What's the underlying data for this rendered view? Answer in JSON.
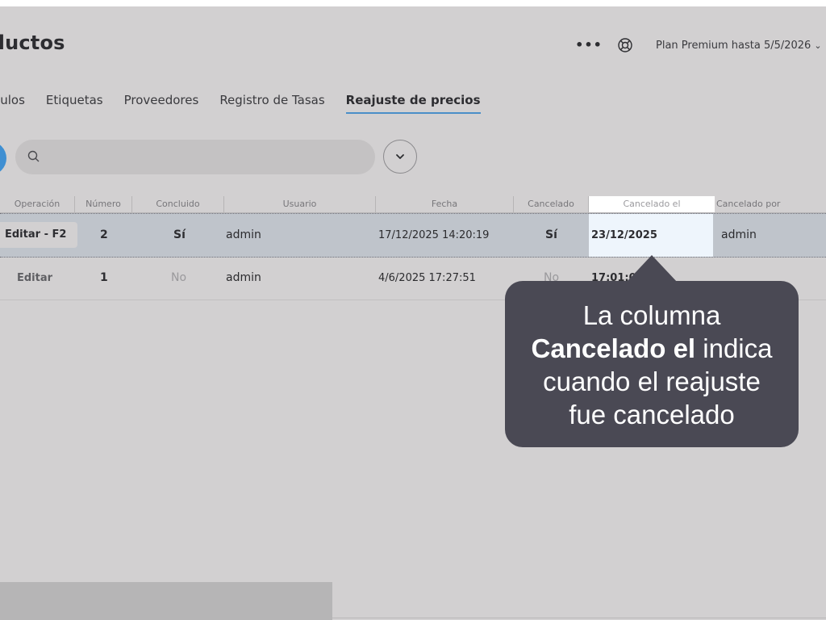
{
  "header": {
    "title": "oductos",
    "more_glyph": "•••",
    "help_icon": "lifebuoy-icon",
    "plan_label": "Plan Premium hasta 5/5/2026"
  },
  "tabs": [
    {
      "label": "culos"
    },
    {
      "label": "Etiquetas"
    },
    {
      "label": "Proveedores"
    },
    {
      "label": "Registro de Tasas"
    },
    {
      "label": "Reajuste de precios",
      "active": true
    }
  ],
  "search": {
    "placeholder": "",
    "icon": "search-icon"
  },
  "filter": {
    "icon": "chevron-down-icon"
  },
  "table": {
    "columns": [
      "Operación",
      "Número",
      "Concluido",
      "Usuario",
      "Fecha",
      "Cancelado",
      "Cancelado el",
      "Cancelado por"
    ],
    "rows": [
      {
        "operacion": "Editar - F2",
        "numero": "2",
        "concluido": "Sí",
        "usuario": "admin",
        "fecha": "17/12/2025 14:20:19",
        "cancelado": "Sí",
        "cancelado_el": "23/12/2025 17:01:01",
        "cancelado_por": "admin"
      },
      {
        "operacion": "Editar",
        "numero": "1",
        "concluido": "No",
        "usuario": "admin",
        "fecha": "4/6/2025 17:27:51",
        "cancelado": "No",
        "cancelado_el": "",
        "cancelado_por": ""
      }
    ]
  },
  "callout": {
    "line1": "La columna",
    "bold": "Cancelado el",
    "after_bold": " indica",
    "line3": "cuando el reajuste",
    "line4": "fue cancelado"
  },
  "colors": {
    "accent": "#3f8fd2",
    "tab_underline": "#4b8fc8",
    "callout_bg": "#4a4954",
    "highlight": "#eef5fc"
  }
}
